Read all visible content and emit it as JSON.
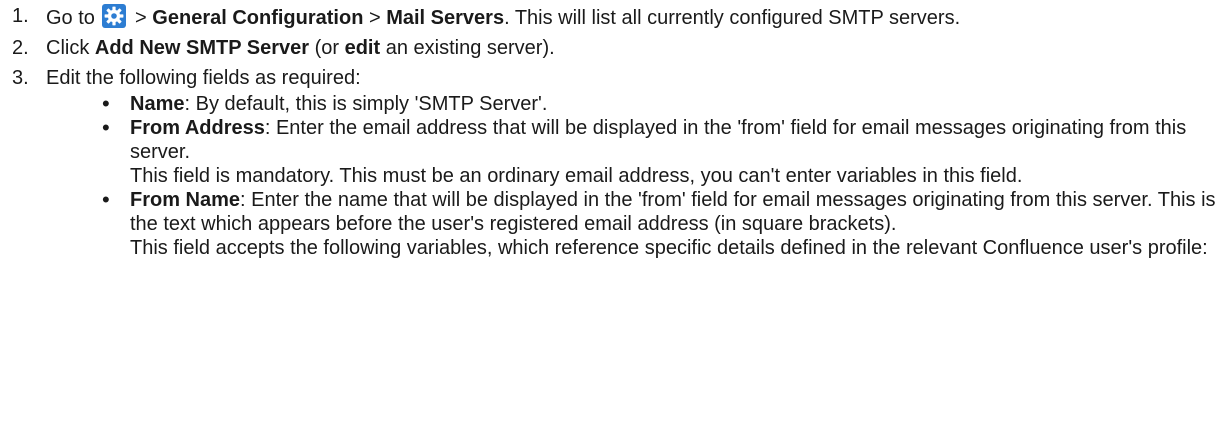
{
  "steps": [
    {
      "number": "1.",
      "prefix": "Go to",
      "icon": "gear-icon",
      "sep1": " > ",
      "bold1": "General Configuration",
      "sep2": " > ",
      "bold2": "Mail Servers",
      "suffix": ". This will list all currently configured SMTP servers."
    },
    {
      "number": "2.",
      "prefix": "Click ",
      "bold1": "Add New SMTP Server",
      "mid": " (or ",
      "bold2": "edit",
      "suffix": " an existing server)."
    },
    {
      "number": "3.",
      "text": "Edit the following fields as required:"
    }
  ],
  "fields": [
    {
      "bullet": "•",
      "label": "Name",
      "desc": ": By default, this is simply 'SMTP Server'."
    },
    {
      "bullet": "•",
      "label": "From Address",
      "desc": ": Enter the email address that will be displayed in the 'from' field for email messages originating from this server.",
      "note": "This field is mandatory. This must be an ordinary email address, you can't enter variables in this field."
    },
    {
      "bullet": "•",
      "label": "From Name",
      "desc": ": Enter the name that will be displayed in the 'from' field for email messages originating from this server. This is the text which appears before the user's registered email address (in square brackets).",
      "note": "This field accepts the following variables, which reference specific details defined in the relevant Confluence user's profile:"
    }
  ],
  "colors": {
    "icon_bg": "#2d7dd2",
    "icon_fg": "#ffffff"
  }
}
